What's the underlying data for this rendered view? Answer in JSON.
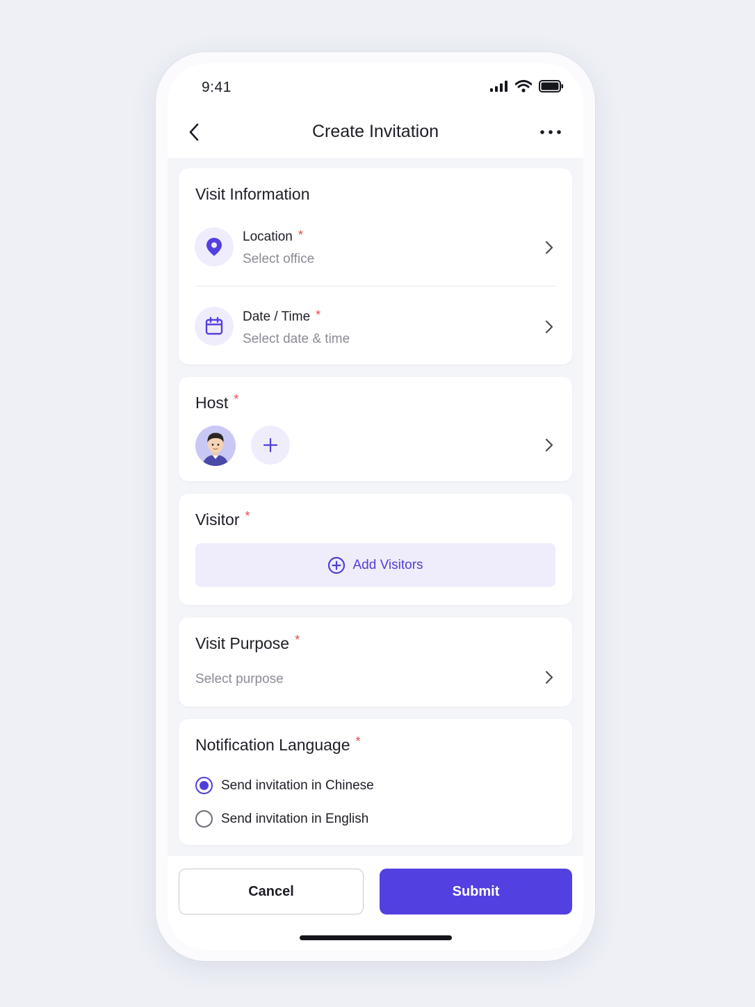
{
  "status_bar": {
    "time": "9:41",
    "icons": [
      "signal-icon",
      "wifi-icon",
      "battery-icon"
    ]
  },
  "header": {
    "title": "Create Invitation",
    "back_icon": "chevron-left-icon",
    "more_icon": "more-horizontal-icon"
  },
  "visit_info": {
    "title": "Visit Information",
    "location": {
      "label": "Location",
      "required": "*",
      "placeholder": "Select office",
      "icon": "map-pin-icon"
    },
    "datetime": {
      "label": "Date / Time",
      "required": "*",
      "placeholder": "Select date & time",
      "icon": "calendar-icon"
    }
  },
  "host": {
    "title": "Host",
    "required": "*",
    "avatar": "avatar",
    "add_icon": "plus-icon"
  },
  "visitor": {
    "title": "Visitor",
    "required": "*",
    "add_label": "Add Visitors",
    "add_icon": "plus-circle-icon"
  },
  "purpose": {
    "title": "Visit Purpose",
    "required": "*",
    "placeholder": "Select purpose"
  },
  "notification": {
    "title": "Notification Language",
    "required": "*",
    "options": [
      {
        "label": "Send invitation in Chinese",
        "checked": true
      },
      {
        "label": "Send invitation in English",
        "checked": false
      }
    ]
  },
  "actions": {
    "cancel": "Cancel",
    "submit": "Submit"
  },
  "colors": {
    "accent": "#5340e0",
    "accent_soft": "#efedfc",
    "required": "#e5484d",
    "muted_text": "#8a8b95"
  }
}
